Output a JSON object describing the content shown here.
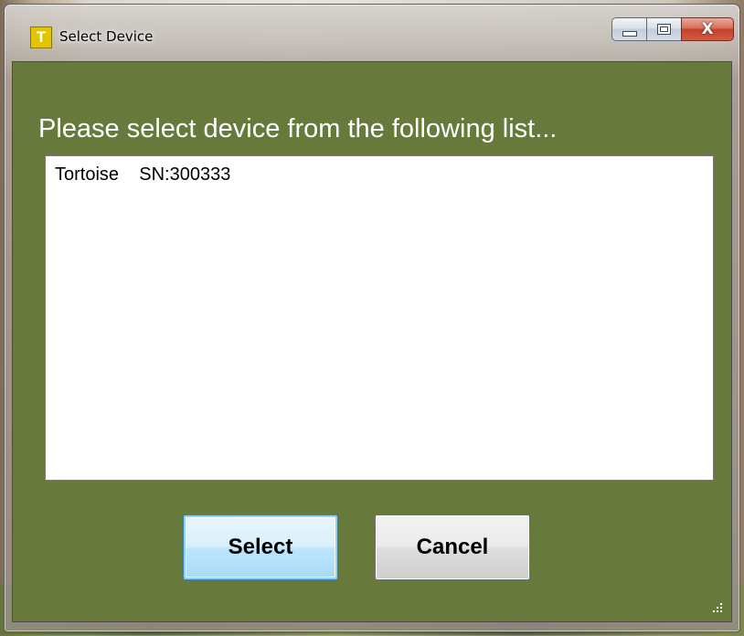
{
  "window": {
    "title": "Select Device",
    "app_icon_letter": "T",
    "client_bg_color": "#677a3c"
  },
  "caption_buttons": {
    "close_glyph": "X"
  },
  "prompt": "Please select device from the following list...",
  "device_list": {
    "items": [
      {
        "name": "Tortoise",
        "serial": "SN:300333",
        "label": "Tortoise    SN:300333"
      }
    ]
  },
  "buttons": {
    "select_label": "Select",
    "cancel_label": "Cancel"
  }
}
